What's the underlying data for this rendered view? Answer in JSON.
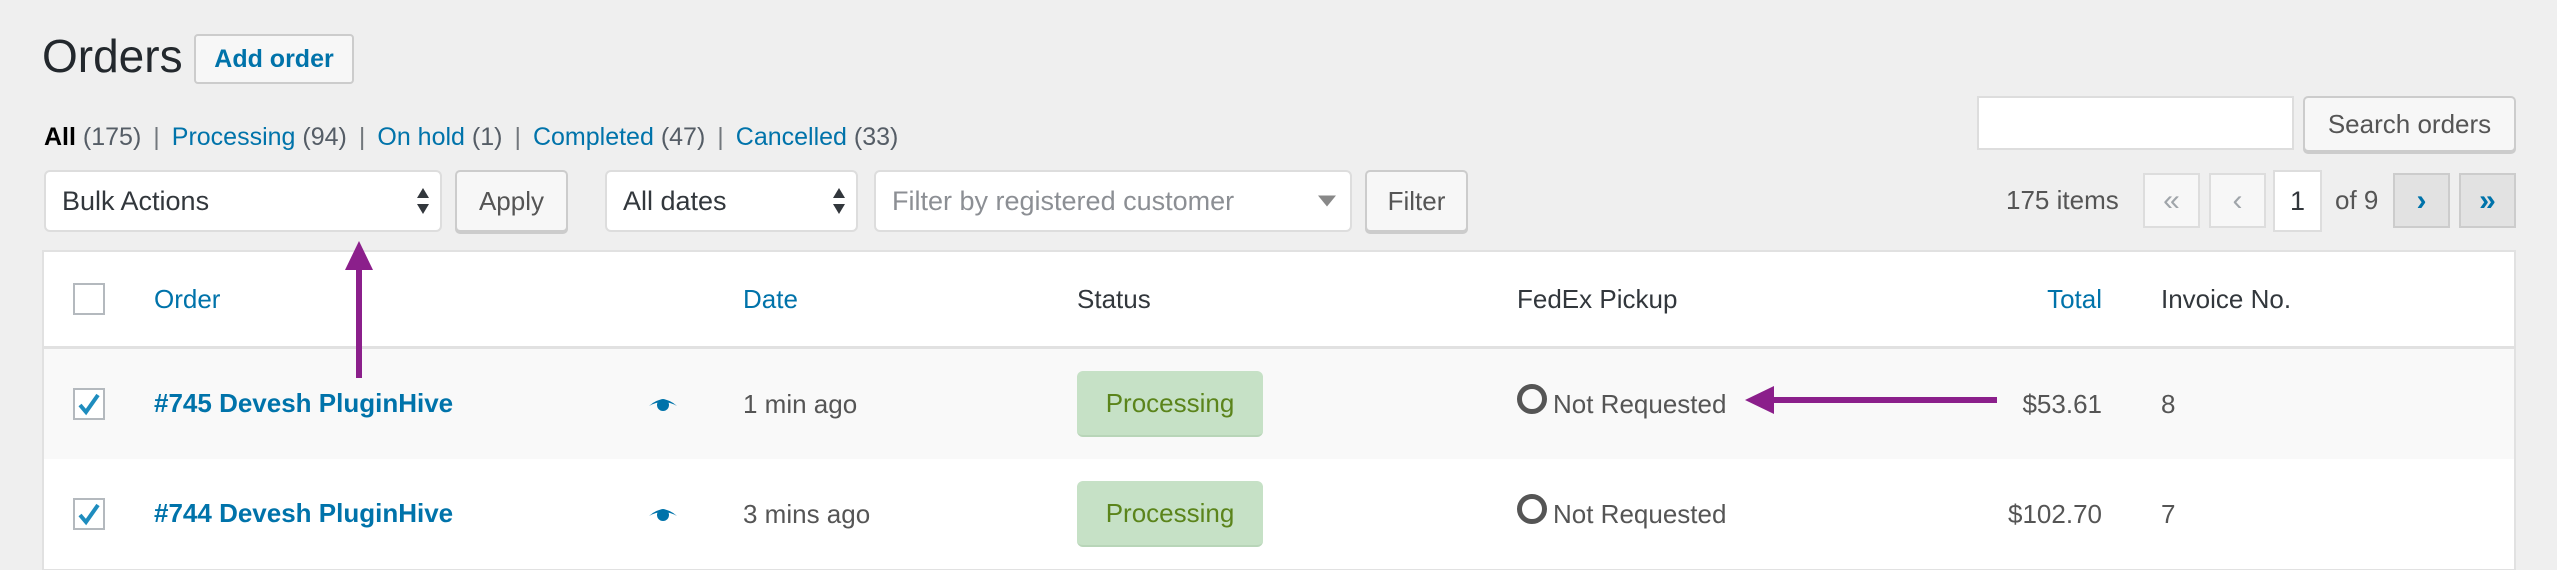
{
  "header": {
    "title": "Orders",
    "add_order_label": "Add order"
  },
  "status_filters": [
    {
      "label": "All",
      "count": "(175)",
      "current": true
    },
    {
      "label": "Processing",
      "count": "(94)",
      "current": false
    },
    {
      "label": "On hold",
      "count": "(1)",
      "current": false
    },
    {
      "label": "Completed",
      "count": "(47)",
      "current": false
    },
    {
      "label": "Cancelled",
      "count": "(33)",
      "current": false
    }
  ],
  "separator": "|",
  "search": {
    "value": "",
    "placeholder": "",
    "button_label": "Search orders"
  },
  "toolbar": {
    "bulk_actions": "Bulk Actions",
    "apply_label": "Apply",
    "dates": "All dates",
    "customer_placeholder": "Filter by registered customer",
    "filter_label": "Filter"
  },
  "pagination": {
    "items_count": "175 items",
    "first_icon": "«",
    "prev_icon": "‹",
    "current_page": "1",
    "of_pages": "of 9",
    "next_icon": "›",
    "last_icon": "»"
  },
  "table": {
    "columns": {
      "order": "Order",
      "date": "Date",
      "status": "Status",
      "fedex": "FedEx Pickup",
      "total": "Total",
      "invoice": "Invoice No."
    },
    "rows": [
      {
        "checked": true,
        "order": "#745 Devesh PluginHive",
        "date": "1 min ago",
        "status": "Processing",
        "fedex": "Not Requested",
        "total": "$53.61",
        "invoice": "8"
      },
      {
        "checked": true,
        "order": "#744 Devesh PluginHive",
        "date": "3 mins ago",
        "status": "Processing",
        "fedex": "Not Requested",
        "total": "$102.70",
        "invoice": "7"
      }
    ]
  },
  "icons": {
    "preview": "eye-icon",
    "fedex_status": "circle-outline-icon",
    "checkbox_checked": "checkmark-icon"
  },
  "colors": {
    "link": "#0073aa",
    "status_processing_bg": "#c6e1c6",
    "status_processing_text": "#5b841b",
    "annotation_arrow": "#8b1f8b"
  }
}
